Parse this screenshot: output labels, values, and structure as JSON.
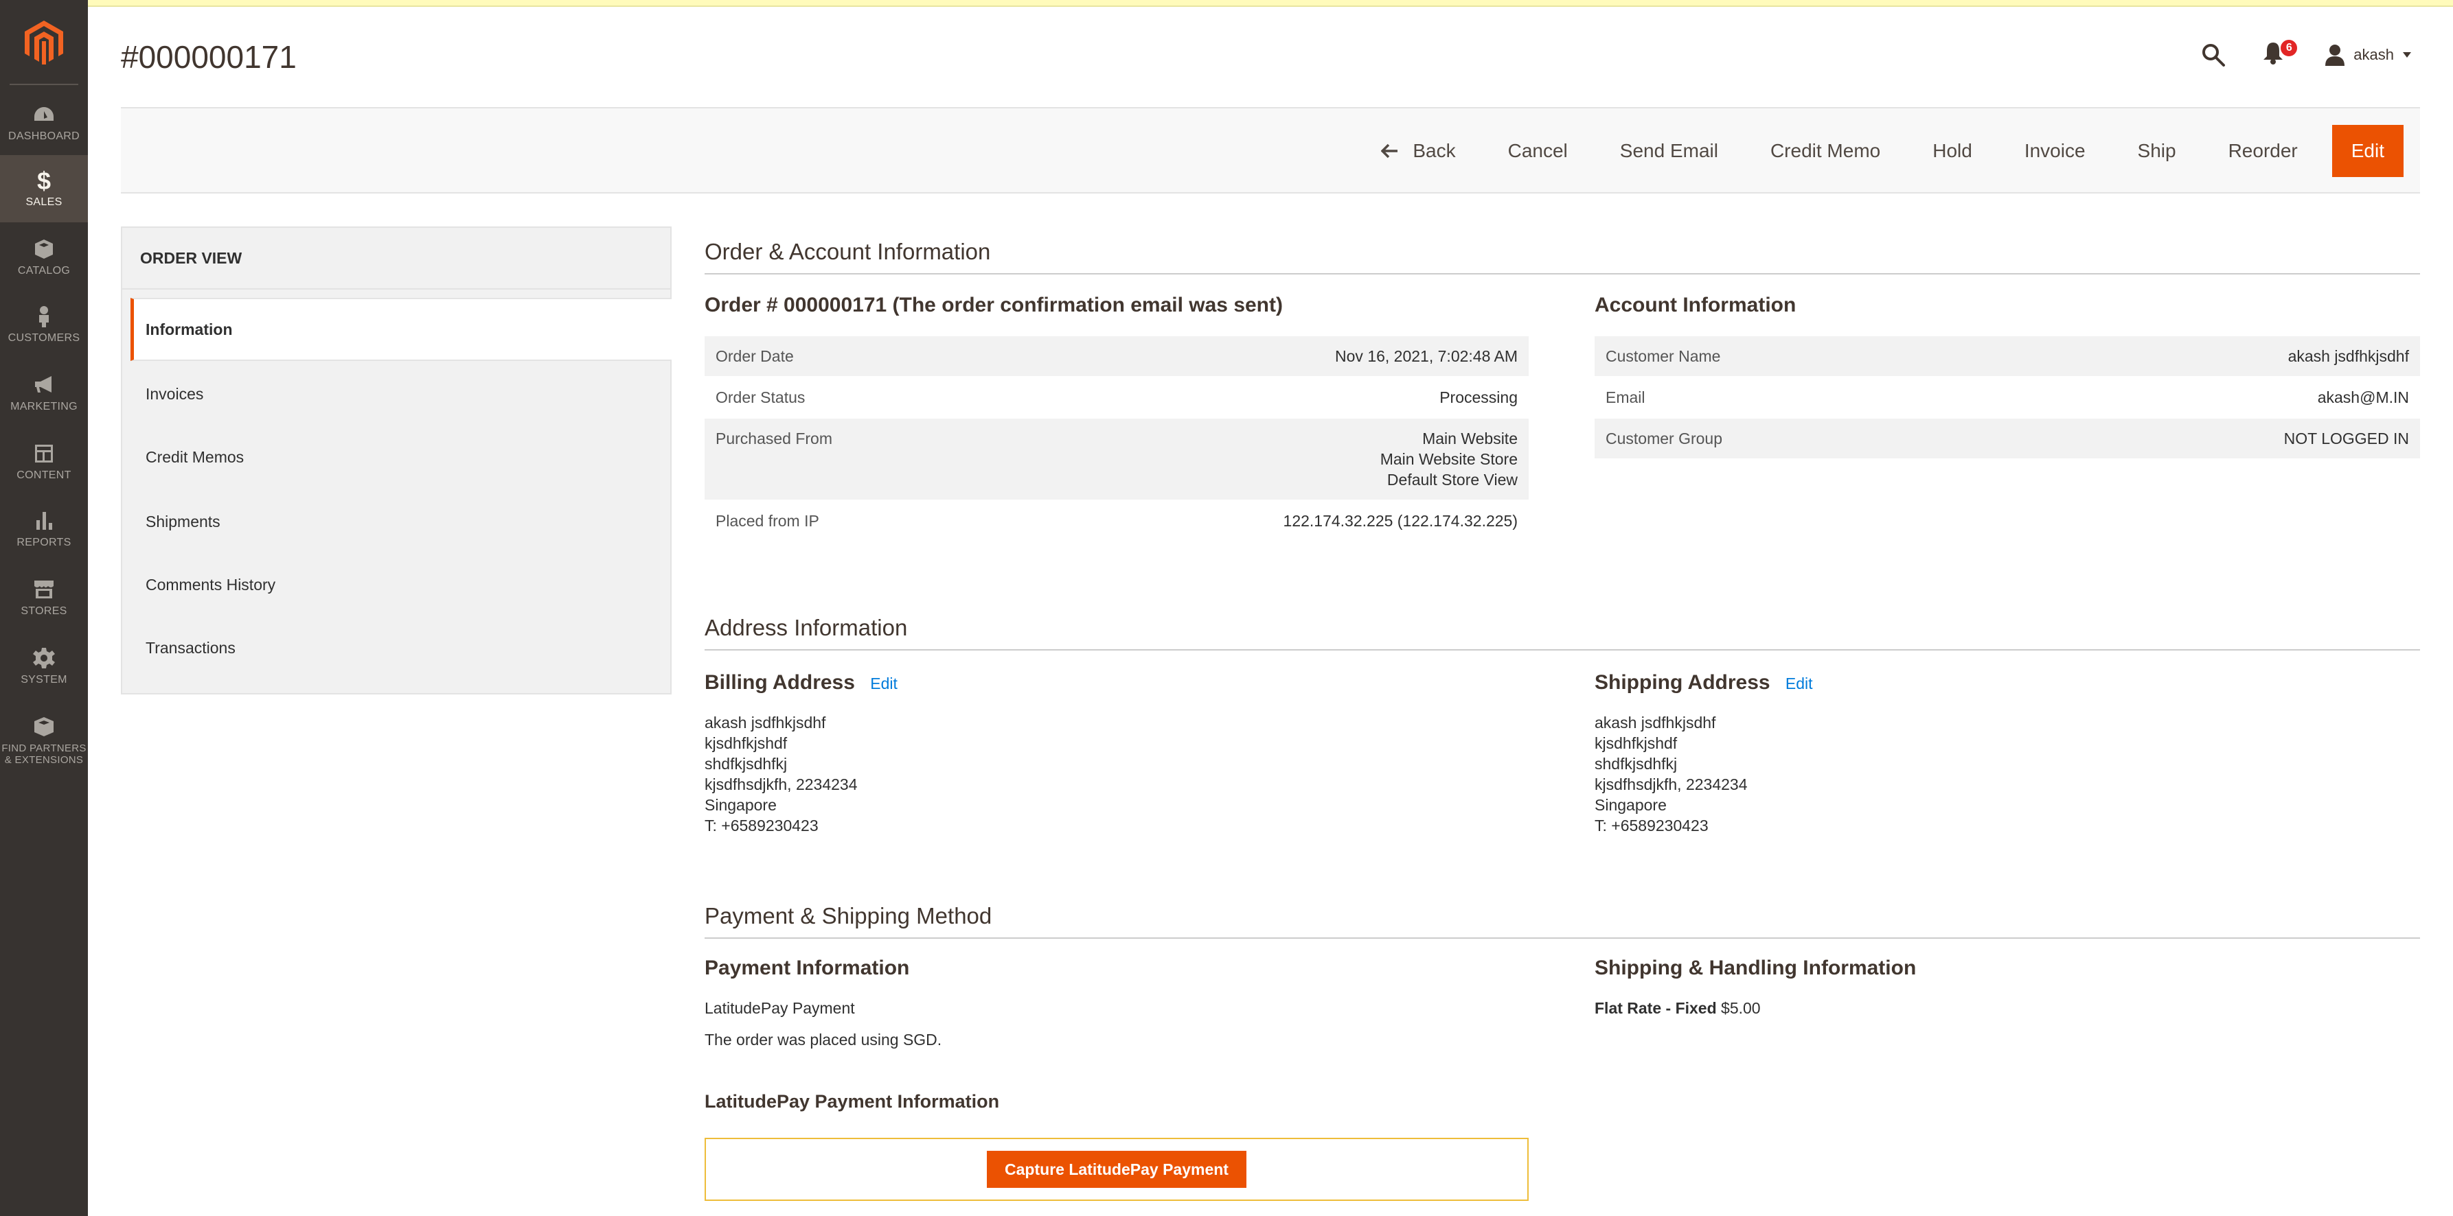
{
  "menu": {
    "items": [
      {
        "label": "DASHBOARD",
        "icon": "dashboard-icon"
      },
      {
        "label": "SALES",
        "icon": "dollar-icon",
        "active": true
      },
      {
        "label": "CATALOG",
        "icon": "box-icon"
      },
      {
        "label": "CUSTOMERS",
        "icon": "person-icon"
      },
      {
        "label": "MARKETING",
        "icon": "megaphone-icon"
      },
      {
        "label": "CONTENT",
        "icon": "layout-icon"
      },
      {
        "label": "REPORTS",
        "icon": "bar-chart-icon"
      },
      {
        "label": "STORES",
        "icon": "storefront-icon"
      },
      {
        "label": "SYSTEM",
        "icon": "gear-icon"
      },
      {
        "label": "FIND PARTNERS & EXTENSIONS",
        "icon": "extensions-box-icon"
      }
    ]
  },
  "header": {
    "title": "#000000171",
    "notifications_count": "6",
    "user_name": "akash"
  },
  "actions": {
    "back": "Back",
    "cancel": "Cancel",
    "send_email": "Send Email",
    "credit_memo": "Credit Memo",
    "hold": "Hold",
    "invoice": "Invoice",
    "ship": "Ship",
    "reorder": "Reorder",
    "edit": "Edit"
  },
  "tabs": {
    "title": "ORDER VIEW",
    "items": [
      "Information",
      "Invoices",
      "Credit Memos",
      "Shipments",
      "Comments History",
      "Transactions"
    ]
  },
  "order_account": {
    "section_title": "Order & Account Information",
    "order_title": "Order # 000000171 (The order confirmation email was sent)",
    "order_rows": [
      {
        "label": "Order Date",
        "value": "Nov 16, 2021, 7:02:48 AM"
      },
      {
        "label": "Order Status",
        "value": "Processing"
      },
      {
        "label": "Purchased From",
        "value_lines": [
          "Main Website",
          "Main Website Store",
          "Default Store View"
        ]
      },
      {
        "label": "Placed from IP",
        "value": "122.174.32.225 (122.174.32.225)"
      }
    ],
    "account_title": "Account Information",
    "account_rows": [
      {
        "label": "Customer Name",
        "value": "akash jsdfhkjsdhf"
      },
      {
        "label": "Email",
        "value": "akash@M.IN"
      },
      {
        "label": "Customer Group",
        "value": "NOT LOGGED IN"
      }
    ]
  },
  "address": {
    "section_title": "Address Information",
    "billing_title": "Billing Address",
    "shipping_title": "Shipping Address",
    "edit_label": "Edit",
    "billing_lines": [
      "akash jsdfhkjsdhf",
      "kjsdhfkjshdf",
      "shdfkjsdhfkj",
      "kjsdfhsdjkfh, 2234234",
      "Singapore",
      "T: +6589230423"
    ],
    "shipping_lines": [
      "akash jsdfhkjsdhf",
      "kjsdhfkjshdf",
      "shdfkjsdhfkj",
      "kjsdfhsdjkfh, 2234234",
      "Singapore",
      "T: +6589230423"
    ]
  },
  "payment_shipping": {
    "section_title": "Payment & Shipping Method",
    "payment_title": "Payment Information",
    "payment_method": "LatitudePay Payment",
    "payment_note": "The order was placed using SGD.",
    "shipping_title": "Shipping & Handling Information",
    "shipping_method": "Flat Rate - Fixed",
    "shipping_price": "$5.00",
    "latitude_title": "LatitudePay Payment Information",
    "capture_button": "Capture LatitudePay Payment"
  },
  "colors": {
    "accent": "#eb5202",
    "menu_bg": "#373330",
    "link": "#007bdb",
    "notification": "#e22626"
  }
}
